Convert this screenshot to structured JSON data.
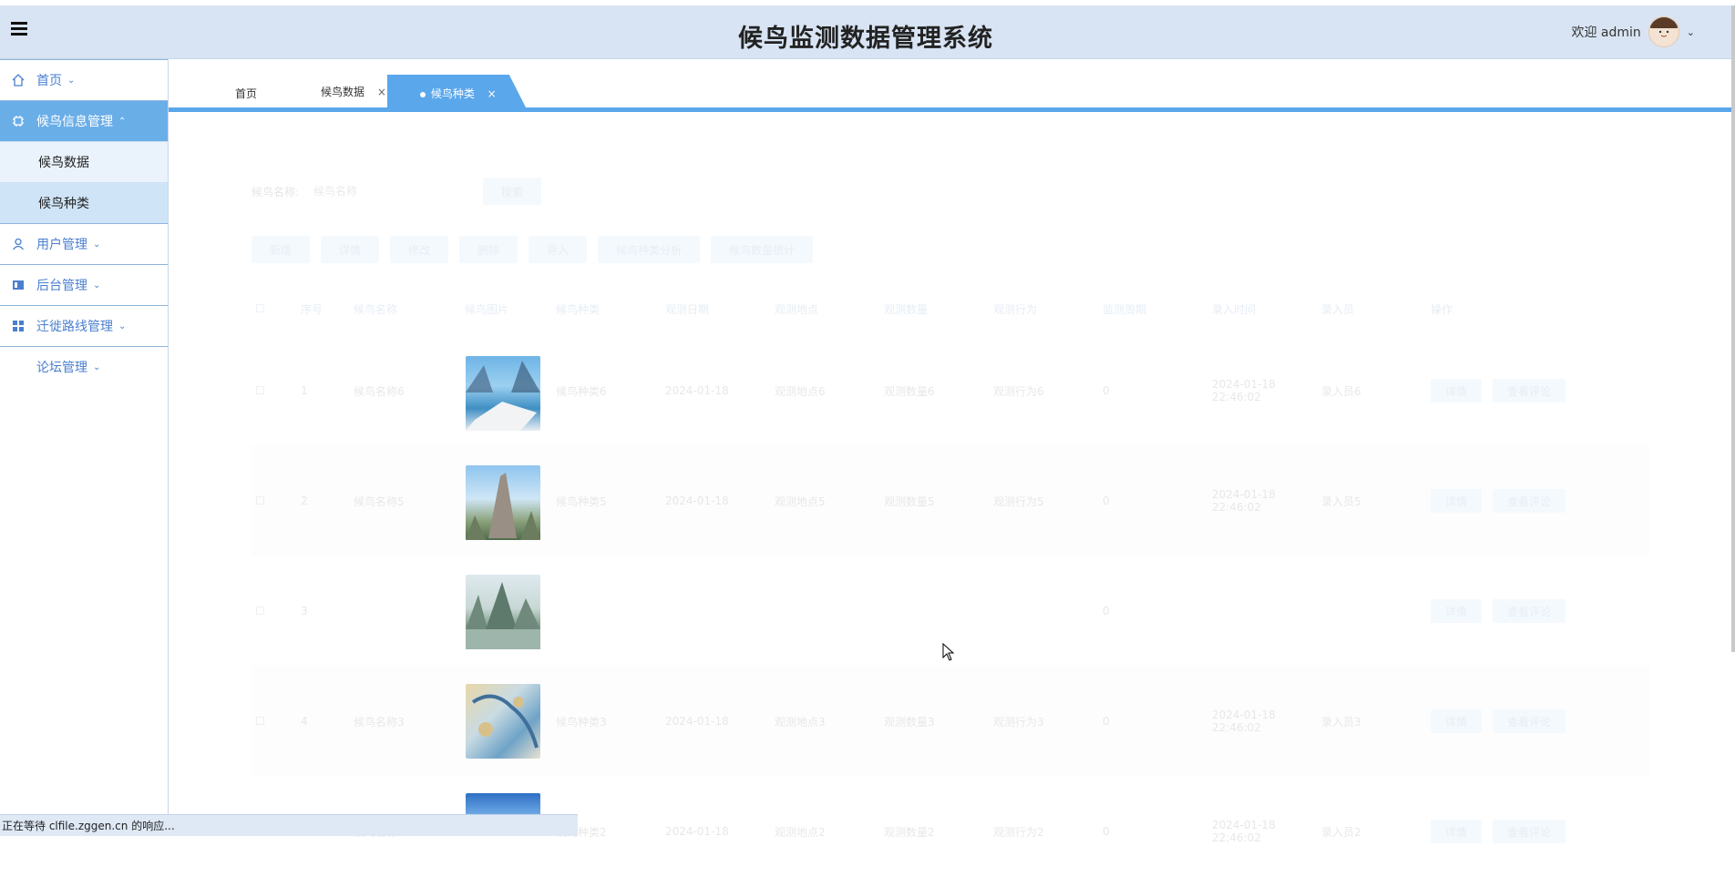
{
  "header": {
    "title": "候鸟监测数据管理系统",
    "welcome": "欢迎 admin",
    "menu_icon": "hamburger-icon",
    "avatar_icon": "user-avatar"
  },
  "sidebar": {
    "items": [
      {
        "label": "首页",
        "icon": "home-icon"
      },
      {
        "label": "候鸟信息管理",
        "icon": "chip-icon"
      },
      {
        "label": "候鸟数据"
      },
      {
        "label": "候鸟种类"
      },
      {
        "label": "用户管理",
        "icon": "user-icon"
      },
      {
        "label": "后台管理",
        "icon": "panel-icon"
      },
      {
        "label": "迁徙路线管理",
        "icon": "grid-icon"
      },
      {
        "label": "论坛管理"
      }
    ]
  },
  "tabs": [
    {
      "label": "首页"
    },
    {
      "label": "候鸟数据"
    },
    {
      "label": "候鸟种类"
    }
  ],
  "search": {
    "label": "候鸟名称:",
    "placeholder": "候鸟名称",
    "button": "搜索"
  },
  "actions": [
    "新增",
    "详情",
    "修改",
    "删除",
    "导入",
    "候鸟种类分析",
    "候鸟数量统计"
  ],
  "table": {
    "headers": [
      "序号",
      "候鸟名称",
      "候鸟图片",
      "候鸟种类",
      "观测日期",
      "观测地点",
      "观测数量",
      "观测行为",
      "监测周期",
      "录入时间",
      "录入员",
      "操作"
    ],
    "rows": [
      {
        "no": "1",
        "name": "候鸟名称6",
        "kind": "候鸟种类6",
        "date": "2024-01-18",
        "place": "观测地点6",
        "count": "观测数量6",
        "behavior": "观测行为6",
        "cycle": "0",
        "time": "2024-01-18 22:46:02",
        "user": "录入员6"
      },
      {
        "no": "2",
        "name": "候鸟名称5",
        "kind": "候鸟种类5",
        "date": "2024-01-18",
        "place": "观测地点5",
        "count": "观测数量5",
        "behavior": "观测行为5",
        "cycle": "0",
        "time": "2024-01-18 22:46:02",
        "user": "录入员5"
      },
      {
        "no": "3",
        "name": "",
        "kind": "",
        "date": "",
        "place": "",
        "count": "",
        "behavior": "",
        "cycle": "0",
        "time": "",
        "user": ""
      },
      {
        "no": "4",
        "name": "候鸟名称3",
        "kind": "候鸟种类3",
        "date": "2024-01-18",
        "place": "观测地点3",
        "count": "观测数量3",
        "behavior": "观测行为3",
        "cycle": "0",
        "time": "2024-01-18 22:46:02",
        "user": "录入员3"
      },
      {
        "no": "5",
        "name": "候鸟名称2",
        "kind": "候鸟种类2",
        "date": "2024-01-18",
        "place": "观测地点2",
        "count": "观测数量2",
        "behavior": "观测行为2",
        "cycle": "0",
        "time": "2024-01-18 22:46:02",
        "user": "录入员2"
      }
    ],
    "row_buttons": [
      "详情",
      "查看评论"
    ]
  },
  "statusbar": {
    "text": "正在等待 clfile.zggen.cn 的响应..."
  }
}
